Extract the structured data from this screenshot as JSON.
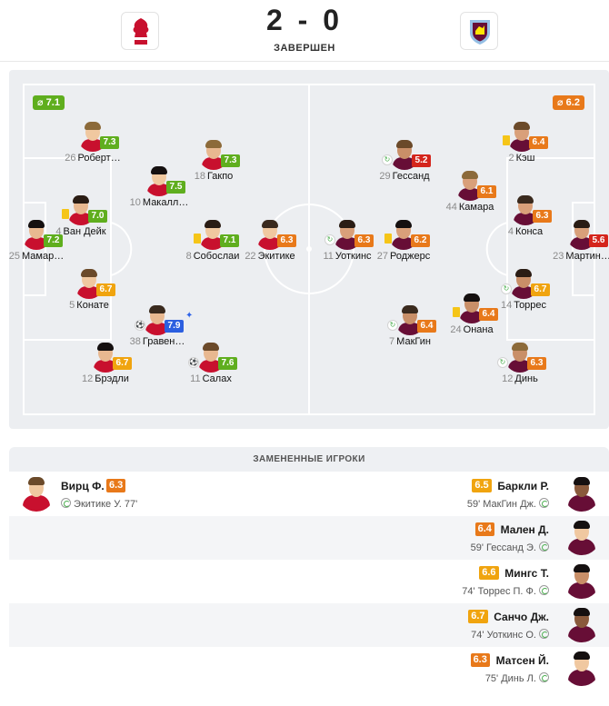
{
  "header": {
    "home_crest": "liverpool-crest",
    "away_crest": "aston-villa-crest",
    "score": "2 - 0",
    "status": "ЗАВЕРШЕН"
  },
  "colors": {
    "green": "#5fae1e",
    "orange": "#e8791a",
    "gold": "#f0a40f",
    "red": "#d4251c",
    "blue": "#2c5fe0"
  },
  "lineups": {
    "home_avg": "⌀ 7.1",
    "away_avg": "⌀ 6.2",
    "home": [
      {
        "num": "12",
        "name": "Брэдли",
        "rating": "6.7",
        "rc": "gold"
      },
      {
        "num": "5",
        "name": "Конате",
        "rating": "6.7",
        "rc": "gold"
      },
      {
        "num": "4",
        "name": "Ван Дейк",
        "rating": "7.0",
        "rc": "green",
        "yellow": true
      },
      {
        "num": "26",
        "name": "Роберт…",
        "rating": "7.3",
        "rc": "green"
      },
      {
        "num": "38",
        "name": "Гравен…",
        "rating": "7.9",
        "rc": "blue",
        "ball": true,
        "star": true
      },
      {
        "num": "10",
        "name": "Макалл…",
        "rating": "7.5",
        "rc": "green"
      },
      {
        "num": "11",
        "name": "Салах",
        "rating": "7.6",
        "rc": "green",
        "ball": true
      },
      {
        "num": "8",
        "name": "Собослаи",
        "rating": "7.1",
        "rc": "green",
        "yellow": true
      },
      {
        "num": "18",
        "name": "Гакпо",
        "rating": "7.3",
        "rc": "green"
      },
      {
        "num": "22",
        "name": "Экитике",
        "rating": "6.3",
        "rc": "orange"
      },
      {
        "num": "25",
        "name": "Мамар…",
        "rating": "7.2",
        "rc": "green"
      }
    ],
    "away": [
      {
        "num": "23",
        "name": "Мартин…",
        "rating": "5.6",
        "rc": "red"
      },
      {
        "num": "12",
        "name": "Динь",
        "rating": "6.3",
        "rc": "orange",
        "sub": true
      },
      {
        "num": "4",
        "name": "Конса",
        "rating": "6.3",
        "rc": "orange"
      },
      {
        "num": "24",
        "name": "Онана",
        "rating": "6.4",
        "rc": "orange",
        "yellow": true
      },
      {
        "num": "2",
        "name": "Кэш",
        "rating": "6.4",
        "rc": "orange",
        "yellow": true
      },
      {
        "num": "14",
        "name": "Торрес",
        "rating": "6.7",
        "rc": "gold",
        "sub": true
      },
      {
        "num": "44",
        "name": "Камара",
        "rating": "6.1",
        "rc": "orange"
      },
      {
        "num": "7",
        "name": "МакГин",
        "rating": "6.4",
        "rc": "orange",
        "sub": true
      },
      {
        "num": "27",
        "name": "Роджерс",
        "rating": "6.2",
        "rc": "orange",
        "yellow": true
      },
      {
        "num": "29",
        "name": "Гессанд",
        "rating": "5.2",
        "rc": "red",
        "sub": true
      },
      {
        "num": "11",
        "name": "Уоткинс",
        "rating": "6.3",
        "rc": "orange",
        "sub": true
      }
    ]
  },
  "subs": {
    "title": "ЗАМЕНЕННЫЕ ИГРОКИ",
    "home": [
      {
        "name": "Вирц Ф.",
        "rating": "6.3",
        "rc": "orange",
        "detail": "Экитике У. 77'"
      }
    ],
    "away": [
      {
        "name": "Баркли Р.",
        "rating": "6.5",
        "rc": "gold",
        "detail": "59' МакГин Дж."
      },
      {
        "name": "Мален Д.",
        "rating": "6.4",
        "rc": "orange",
        "detail": "59' Гессанд Э."
      },
      {
        "name": "Мингс Т.",
        "rating": "6.6",
        "rc": "gold",
        "detail": "74' Торрес П. Ф."
      },
      {
        "name": "Санчо Дж.",
        "rating": "6.7",
        "rc": "gold",
        "detail": "74' Уоткинс О."
      },
      {
        "name": "Матсен Й.",
        "rating": "6.3",
        "rc": "orange",
        "detail": "75' Динь Л."
      }
    ]
  }
}
